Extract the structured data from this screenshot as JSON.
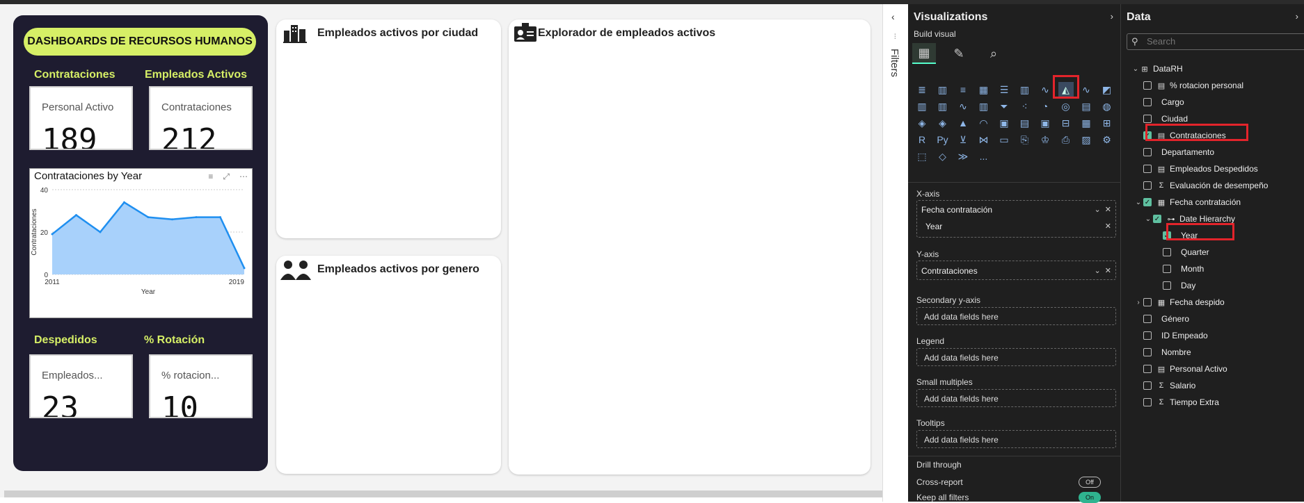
{
  "dashboard": {
    "title": "DASHBOARDS DE RECURSOS HUMANOS",
    "kpis": [
      {
        "heading": "Contrataciones",
        "label": "Personal Activo",
        "value": "189"
      },
      {
        "heading": "Empleados Activos",
        "label": "Contrataciones",
        "value": "212"
      },
      {
        "heading": "Despedidos",
        "label": "Empleados...",
        "value": "23"
      },
      {
        "heading": "% Rotación",
        "label": "% rotacion...",
        "value": "10"
      }
    ],
    "cards": {
      "city": "Empleados activos por ciudad",
      "gender": "Empleados activos por genero",
      "explorer": "Explorador de empleados activos"
    }
  },
  "chart_data": {
    "type": "area",
    "title": "Contrataciones by Year",
    "xlabel": "Year",
    "ylabel": "Contrataciones",
    "x": [
      2011,
      2012,
      2013,
      2014,
      2015,
      2016,
      2017,
      2018,
      2019
    ],
    "values": [
      19,
      28,
      20,
      34,
      27,
      26,
      27,
      27,
      3
    ],
    "x_tick_labels": [
      "2011",
      "2019"
    ],
    "y_ticks": [
      "0",
      "20",
      "40"
    ],
    "ylim": [
      0,
      40
    ],
    "xlim": [
      2011,
      2019
    ],
    "color": "#1f8ff0",
    "fill": "#a8d1fb",
    "grid": true
  },
  "filters": {
    "label": "Filters"
  },
  "viz": {
    "title": "Visualizations",
    "build": "Build visual",
    "xaxis": {
      "label": "X-axis",
      "field": "Fecha contratación",
      "sub": "Year"
    },
    "yaxis": {
      "label": "Y-axis",
      "field": "Contrataciones"
    },
    "secondary": {
      "label": "Secondary y-axis",
      "placeholder": "Add data fields here"
    },
    "legend": {
      "label": "Legend",
      "placeholder": "Add data fields here"
    },
    "small": {
      "label": "Small multiples",
      "placeholder": "Add data fields here"
    },
    "tooltips": {
      "label": "Tooltips",
      "placeholder": "Add data fields here"
    },
    "drill": {
      "label": "Drill through"
    },
    "cross": {
      "label": "Cross-report",
      "toggle": "Off"
    },
    "keep": {
      "label": "Keep all filters",
      "toggle": "On"
    },
    "more": "...",
    "rtext": "R",
    "pytext": "Py"
  },
  "data_pane": {
    "title": "Data",
    "search_placeholder": "Search",
    "table": "DataRH",
    "fields": [
      {
        "name": "% rotacion personal",
        "icon": "calc",
        "checked": false
      },
      {
        "name": "Cargo",
        "icon": "",
        "checked": false
      },
      {
        "name": "Ciudad",
        "icon": "",
        "checked": false
      },
      {
        "name": "Contrataciones",
        "icon": "calc",
        "checked": true
      },
      {
        "name": "Departamento",
        "icon": "",
        "checked": false
      },
      {
        "name": "Empleados Despedidos",
        "icon": "calc",
        "checked": false
      },
      {
        "name": "Evaluación de desempeño",
        "icon": "sigma",
        "checked": false
      },
      {
        "name": "Fecha contratación",
        "icon": "calendar",
        "checked": true
      },
      {
        "name": "Date Hierarchy",
        "icon": "hier",
        "checked": true
      },
      {
        "name": "Year",
        "icon": "",
        "checked": true
      },
      {
        "name": "Quarter",
        "icon": "",
        "checked": false
      },
      {
        "name": "Month",
        "icon": "",
        "checked": false
      },
      {
        "name": "Day",
        "icon": "",
        "checked": false
      },
      {
        "name": "Fecha despido",
        "icon": "calendar",
        "checked": false
      },
      {
        "name": "Género",
        "icon": "",
        "checked": false
      },
      {
        "name": "ID Empeado",
        "icon": "",
        "checked": false
      },
      {
        "name": "Nombre",
        "icon": "",
        "checked": false
      },
      {
        "name": "Personal Activo",
        "icon": "calc",
        "checked": false
      },
      {
        "name": "Salario",
        "icon": "sigma",
        "checked": false
      },
      {
        "name": "Tiempo Extra",
        "icon": "sigma",
        "checked": false
      }
    ]
  }
}
